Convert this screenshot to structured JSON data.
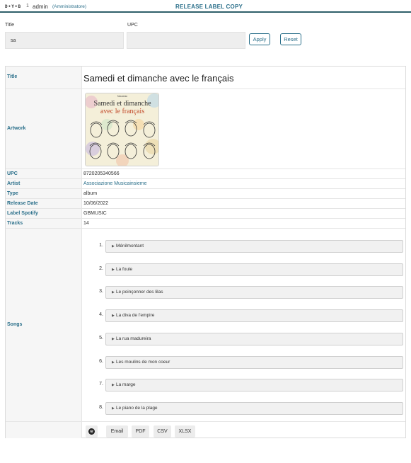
{
  "header": {
    "logo_text": "D•Y•B",
    "bell_count": "1",
    "user_name": "admin",
    "user_role": "(Amministratore)",
    "page_title": "RELEASE LABEL COPY",
    "accent_color": "#2a6f8a"
  },
  "filters": {
    "title_label": "Title",
    "title_value": "sa",
    "upc_label": "UPC",
    "upc_value": "",
    "apply_label": "Apply",
    "reset_label": "Reset"
  },
  "release": {
    "labels": {
      "title": "Title",
      "artwork": "Artwork",
      "upc": "UPC",
      "artist": "Artist",
      "type": "Type",
      "release_date": "Release Date",
      "label_spotify": "Label Spotify",
      "tracks": "Tracks",
      "songs": "Songs"
    },
    "title": "Samedi et dimanche avec le français",
    "artwork_text": {
      "top": "Nouveau",
      "line1": "Samedi et dimanche",
      "line2": "avec le français"
    },
    "upc": "8720205340566",
    "artist": "Associazione Musicainsieme",
    "type": "album",
    "release_date": "10/06/2022",
    "label_spotify": "GBMUSIC",
    "tracks": "14",
    "songs": [
      {
        "num": "1.",
        "name": "Ménilmontant"
      },
      {
        "num": "2.",
        "name": "La foule"
      },
      {
        "num": "3.",
        "name": "Le poinçonner des lilas"
      },
      {
        "num": "4.",
        "name": "La diva de l'empire"
      },
      {
        "num": "5.",
        "name": "La rua madureira"
      },
      {
        "num": "6.",
        "name": "Les moulins de mon coeur"
      },
      {
        "num": "7.",
        "name": "La marge"
      },
      {
        "num": "8.",
        "name": "Le piano de la plage"
      }
    ]
  },
  "actions": {
    "spotify_icon": "spotify-icon",
    "email_label": "Email",
    "pdf_label": "PDF",
    "csv_label": "CSV",
    "xlsx_label": "XLSX"
  }
}
